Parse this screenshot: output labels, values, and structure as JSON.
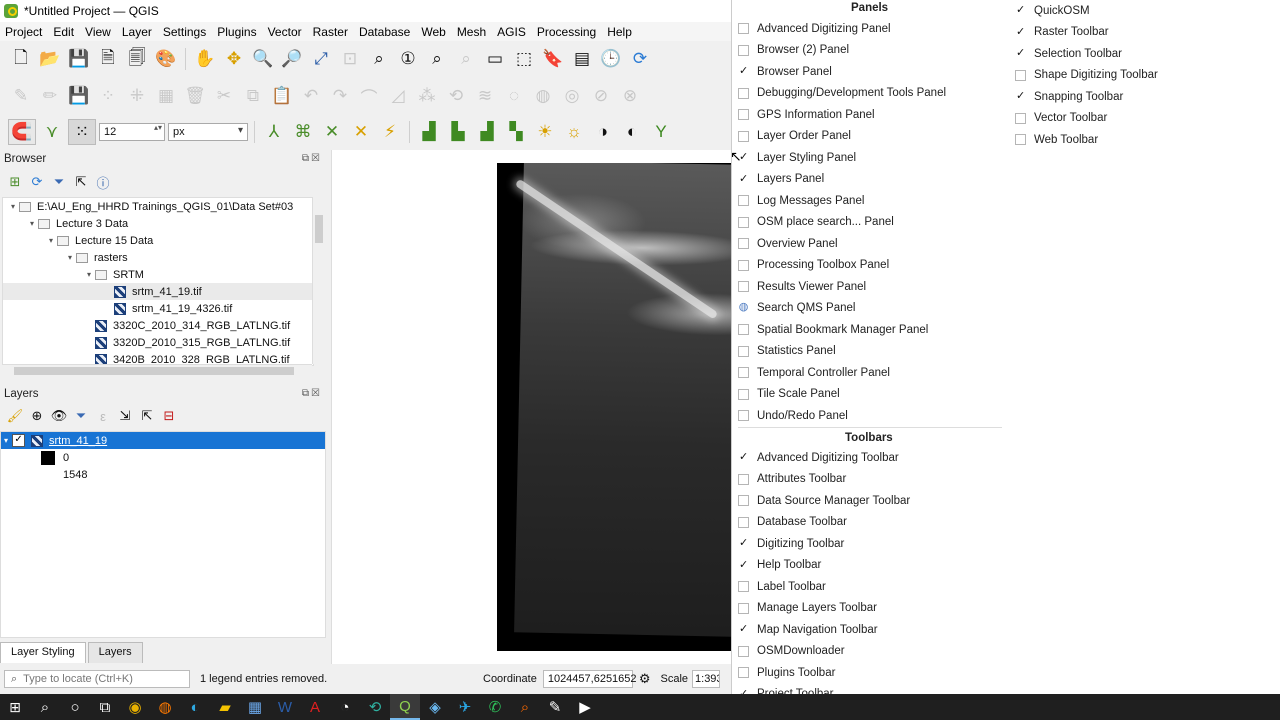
{
  "window": {
    "title": "*Untitled Project — QGIS"
  },
  "menubar": [
    "Project",
    "Edit",
    "View",
    "Layer",
    "Settings",
    "Plugins",
    "Vector",
    "Raster",
    "Database",
    "Web",
    "Mesh",
    "AGIS",
    "Processing",
    "Help"
  ],
  "toolbar": {
    "size_value": "12",
    "unit_value": "px"
  },
  "browser": {
    "title": "Browser",
    "tree": [
      {
        "label": "E:\\AU_Eng_HHRD Trainings_QGIS_01\\Data Set#03",
        "depth": 0,
        "type": "folder",
        "expanded": true
      },
      {
        "label": "Lecture 3 Data",
        "depth": 1,
        "type": "folder",
        "expanded": true
      },
      {
        "label": "Lecture 15 Data",
        "depth": 2,
        "type": "folder",
        "expanded": true
      },
      {
        "label": "rasters",
        "depth": 3,
        "type": "folder",
        "expanded": true
      },
      {
        "label": "SRTM",
        "depth": 4,
        "type": "folder",
        "expanded": true
      },
      {
        "label": "srtm_41_19.tif",
        "depth": 5,
        "type": "raster",
        "selected": true
      },
      {
        "label": "srtm_41_19_4326.tif",
        "depth": 5,
        "type": "raster"
      },
      {
        "label": "3320C_2010_314_RGB_LATLNG.tif",
        "depth": 4,
        "type": "raster"
      },
      {
        "label": "3320D_2010_315_RGB_LATLNG.tif",
        "depth": 4,
        "type": "raster"
      },
      {
        "label": "3420B_2010_328_RGB_LATLNG.tif",
        "depth": 4,
        "type": "raster"
      }
    ]
  },
  "layers": {
    "title": "Layers",
    "layer_name": "srtm_41_19",
    "legend_min": "0",
    "legend_max": "1548"
  },
  "bottom_tabs": [
    "Layer Styling",
    "Layers"
  ],
  "statusbar": {
    "locate_placeholder": "Type to locate (Ctrl+K)",
    "message": "1 legend entries removed.",
    "coordinate_label": "Coordinate",
    "coordinate_value": "1024457,6251652",
    "scale_label": "Scale",
    "scale_value": "1:393"
  },
  "popup": {
    "panels_title": "Panels",
    "panels": [
      {
        "label": "Advanced Digitizing Panel",
        "checked": false
      },
      {
        "label": "Browser (2) Panel",
        "checked": false
      },
      {
        "label": "Browser Panel",
        "checked": true
      },
      {
        "label": "Debugging/Development Tools Panel",
        "checked": false
      },
      {
        "label": "GPS Information Panel",
        "checked": false
      },
      {
        "label": "Layer Order Panel",
        "checked": false
      },
      {
        "label": "Layer Styling Panel",
        "checked": true
      },
      {
        "label": "Layers Panel",
        "checked": true
      },
      {
        "label": "Log Messages Panel",
        "checked": false
      },
      {
        "label": "OSM place search... Panel",
        "checked": false
      },
      {
        "label": "Overview Panel",
        "checked": false
      },
      {
        "label": "Processing Toolbox Panel",
        "checked": false
      },
      {
        "label": "Results Viewer Panel",
        "checked": false
      },
      {
        "label": "Search QMS Panel",
        "checked": false,
        "icon": true
      },
      {
        "label": "Spatial Bookmark Manager Panel",
        "checked": false
      },
      {
        "label": "Statistics Panel",
        "checked": false
      },
      {
        "label": "Temporal Controller Panel",
        "checked": false
      },
      {
        "label": "Tile Scale Panel",
        "checked": false
      },
      {
        "label": "Undo/Redo Panel",
        "checked": false
      }
    ],
    "toolbars_title": "Toolbars",
    "toolbars": [
      {
        "label": "Advanced Digitizing Toolbar",
        "checked": true
      },
      {
        "label": "Attributes Toolbar",
        "checked": false
      },
      {
        "label": "Data Source Manager Toolbar",
        "checked": false
      },
      {
        "label": "Database Toolbar",
        "checked": false
      },
      {
        "label": "Digitizing Toolbar",
        "checked": true
      },
      {
        "label": "Help Toolbar",
        "checked": true
      },
      {
        "label": "Label Toolbar",
        "checked": false
      },
      {
        "label": "Manage Layers Toolbar",
        "checked": false
      },
      {
        "label": "Map Navigation Toolbar",
        "checked": true
      },
      {
        "label": "OSMDownloader",
        "checked": false
      },
      {
        "label": "Plugins Toolbar",
        "checked": false
      },
      {
        "label": "Project Toolbar",
        "checked": true
      }
    ],
    "toolbars_col2": [
      {
        "label": "QuickOSM",
        "checked": true
      },
      {
        "label": "Raster Toolbar",
        "checked": true
      },
      {
        "label": "Selection Toolbar",
        "checked": true
      },
      {
        "label": "Shape Digitizing Toolbar",
        "checked": false
      },
      {
        "label": "Snapping Toolbar",
        "checked": true
      },
      {
        "label": "Vector Toolbar",
        "checked": false
      },
      {
        "label": "Web Toolbar",
        "checked": false
      }
    ]
  },
  "colors": {
    "selection_blue": "#1874d4",
    "accent_green": "#5ba33a"
  }
}
